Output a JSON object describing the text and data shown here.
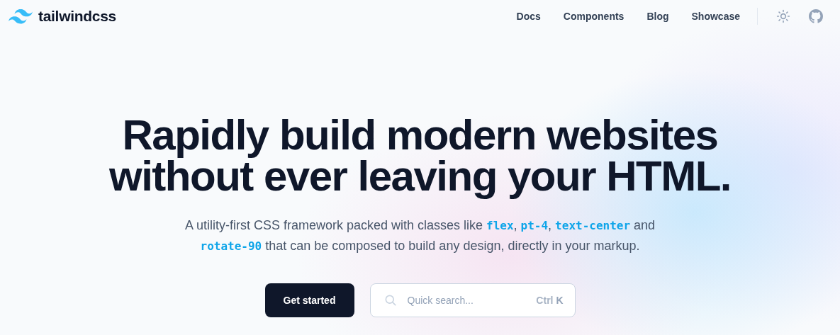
{
  "header": {
    "logo": "tailwindcss",
    "nav": [
      "Docs",
      "Components",
      "Blog",
      "Showcase"
    ]
  },
  "hero": {
    "title": "Rapidly build modern websites without ever leaving your HTML.",
    "subtitle": [
      {
        "kind": "text",
        "text": "A utility-first CSS framework packed with classes like "
      },
      {
        "kind": "code",
        "text": "flex"
      },
      {
        "kind": "text",
        "text": ", "
      },
      {
        "kind": "code",
        "text": "pt-4"
      },
      {
        "kind": "text",
        "text": ", "
      },
      {
        "kind": "code",
        "text": "text-center"
      },
      {
        "kind": "text",
        "text": " and "
      },
      {
        "kind": "code",
        "text": "rotate-90"
      },
      {
        "kind": "text",
        "text": " that can be composed to build any design, directly in your markup."
      }
    ],
    "cta": "Get started",
    "search": {
      "placeholder": "Quick search...",
      "shortcut": [
        "Ctrl",
        "K"
      ]
    }
  }
}
